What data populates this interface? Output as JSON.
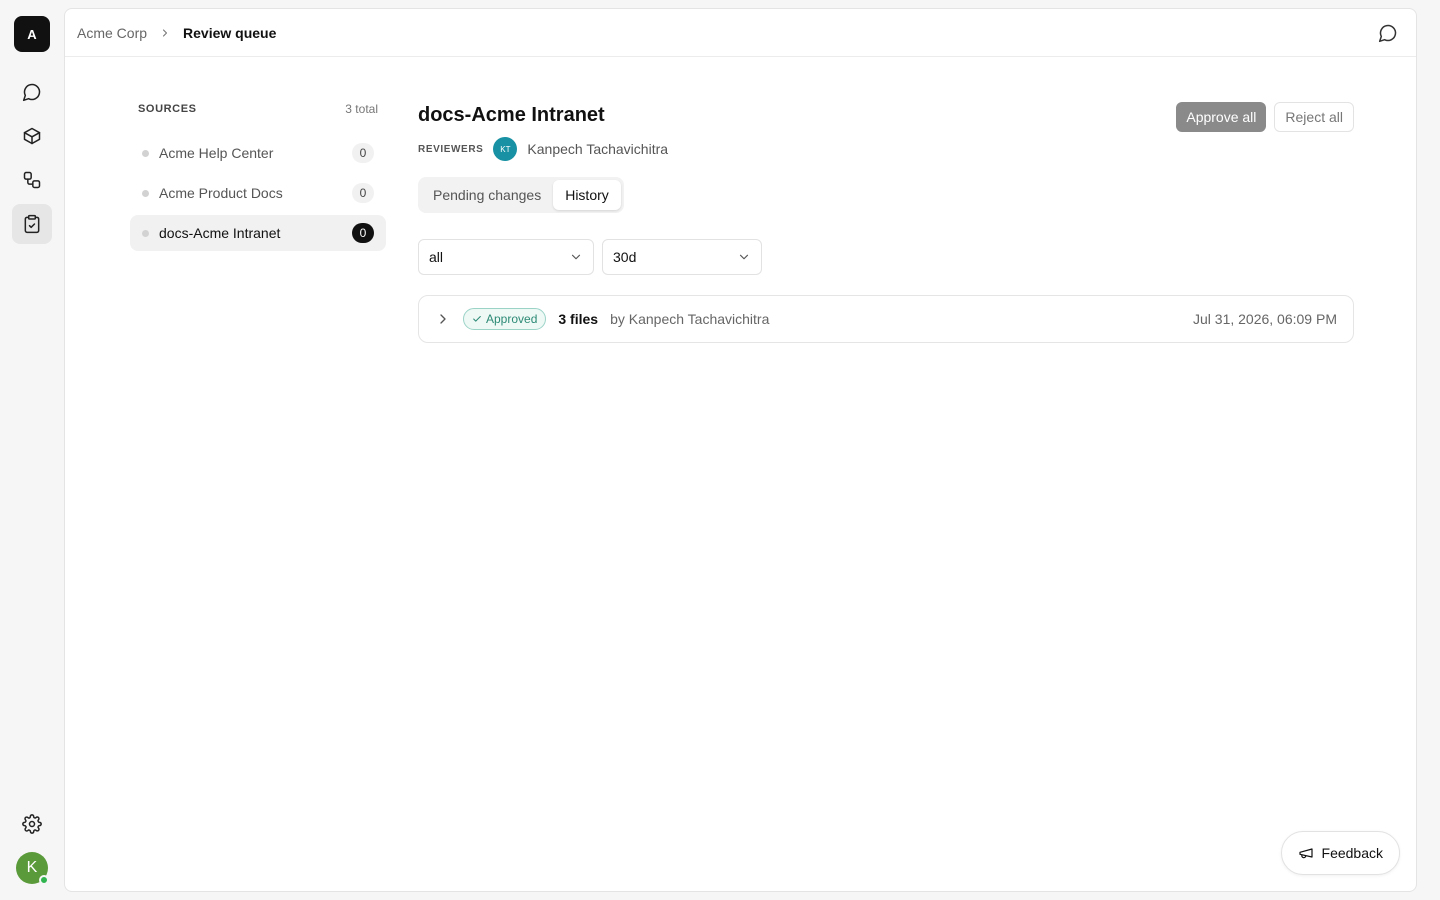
{
  "workspace": {
    "initial": "A"
  },
  "rail": {
    "items": [
      {
        "name": "chat-icon"
      },
      {
        "name": "cube-icon"
      },
      {
        "name": "workflow-icon"
      },
      {
        "name": "clipboard-check-icon"
      }
    ],
    "settings_icon": "gear-icon",
    "user_initial": "K"
  },
  "breadcrumb": {
    "root": "Acme Corp",
    "current": "Review queue"
  },
  "sources": {
    "title": "SOURCES",
    "total": "3 total",
    "items": [
      {
        "name": "Acme Help Center",
        "count": "0"
      },
      {
        "name": "Acme Product Docs",
        "count": "0"
      },
      {
        "name": "docs-Acme Intranet",
        "count": "0"
      }
    ]
  },
  "detail": {
    "title": "docs-Acme Intranet",
    "reviewers_label": "REVIEWERS",
    "reviewer": {
      "initials": "KT",
      "name": "Kanpech Tachavichitra"
    },
    "approve_label": "Approve all",
    "reject_label": "Reject all",
    "tabs": [
      {
        "label": "Pending changes"
      },
      {
        "label": "History"
      }
    ],
    "filters": {
      "type": "all",
      "range": "30d"
    },
    "history": [
      {
        "status": "Approved",
        "files": "3 files",
        "by": "by Kanpech Tachavichitra",
        "date": "Jul 31, 2026, 06:09 PM"
      }
    ]
  },
  "feedback_label": "Feedback",
  "colors": {
    "approved": "#2c8a75",
    "reviewer_avatar": "#1791a3",
    "user_avatar": "#5b9a3a"
  }
}
